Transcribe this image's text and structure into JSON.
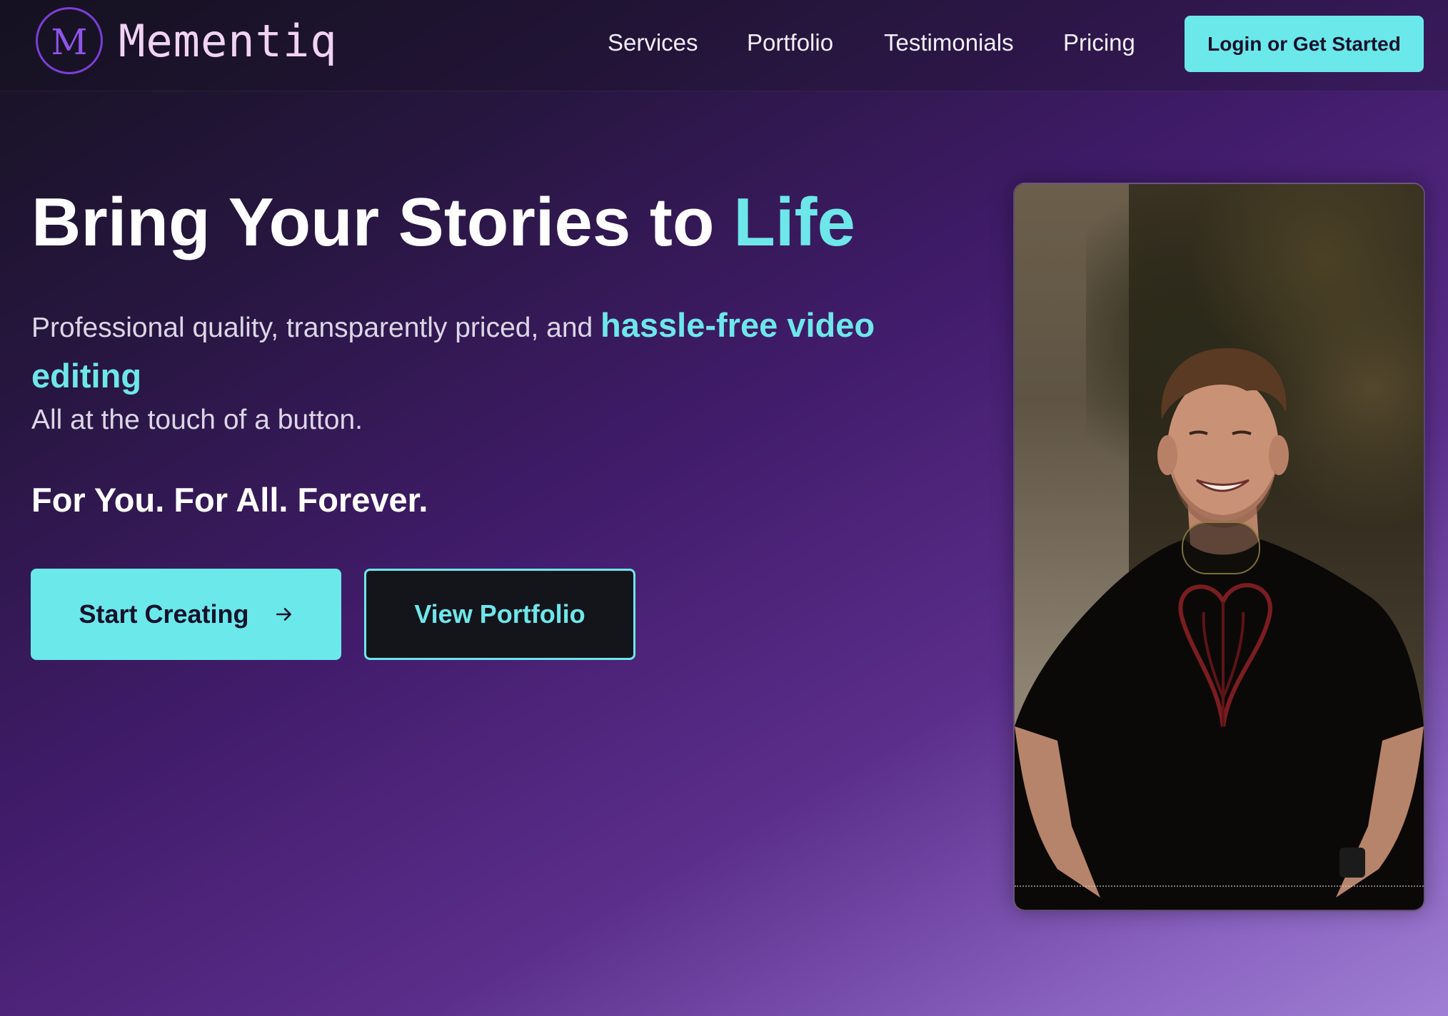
{
  "brand": {
    "logo_letter": "M",
    "name": "Mementiq"
  },
  "nav": {
    "items": [
      {
        "label": "Services"
      },
      {
        "label": "Portfolio"
      },
      {
        "label": "Testimonials"
      },
      {
        "label": "Pricing"
      }
    ],
    "cta_label": "Login or Get Started"
  },
  "hero": {
    "title_main": "Bring Your Stories to ",
    "title_accent": "Life",
    "subtitle_text": "Professional quality, transparently priced, and ",
    "subtitle_highlight": "hassle-free video editing",
    "subtitle_line2": "All at the touch of a button.",
    "tagline": "For You. For All. Forever.",
    "primary_button_label": "Start Creating",
    "secondary_button_label": "View Portfolio"
  },
  "icons": {
    "primary_button_icon": "arrow-right-icon",
    "video_control_icon": "play-icon"
  },
  "colors": {
    "accent": "#6ae8ea",
    "logo_purple": "#7b3fd6",
    "background_dark": "#161222",
    "background_light": "#9f7fd4",
    "button_dark": "#14151b"
  }
}
